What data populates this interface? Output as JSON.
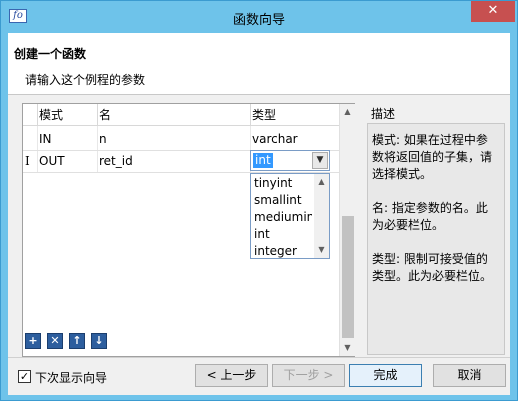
{
  "window": {
    "title": "函数向导",
    "icon_text": "fo",
    "close_glyph": "✕"
  },
  "header": {
    "title": "创建一个函数",
    "subtitle": "请输入这个例程的参数"
  },
  "grid": {
    "columns": [
      "模式",
      "名",
      "类型"
    ],
    "rows": [
      {
        "mode": "IN",
        "name": "n",
        "type": "varchar"
      },
      {
        "mode": "OUT",
        "name": "ret_id",
        "type": "int"
      }
    ],
    "edit_cursor": "I",
    "type_dropdown_options": [
      "tinyint",
      "smallint",
      "mediumint",
      "int",
      "integer"
    ]
  },
  "toolbar": {
    "add_label": "+",
    "delete_label": "✕",
    "up_label": "↑",
    "down_label": "↓"
  },
  "description": {
    "label": "描述",
    "mode_text": "模式: 如果在过程中参数将返回值的子集，请选择模式。",
    "name_text": "名: 指定参数的名。此为必要栏位。",
    "type_text": "类型: 限制可接受值的类型。此为必要栏位。"
  },
  "footer": {
    "show_wizard_checked": true,
    "show_wizard_label": "下次显示向导",
    "prev_label": "< 上一步",
    "next_label": "下一步 >",
    "finish_label": "完成",
    "cancel_label": "取消"
  }
}
